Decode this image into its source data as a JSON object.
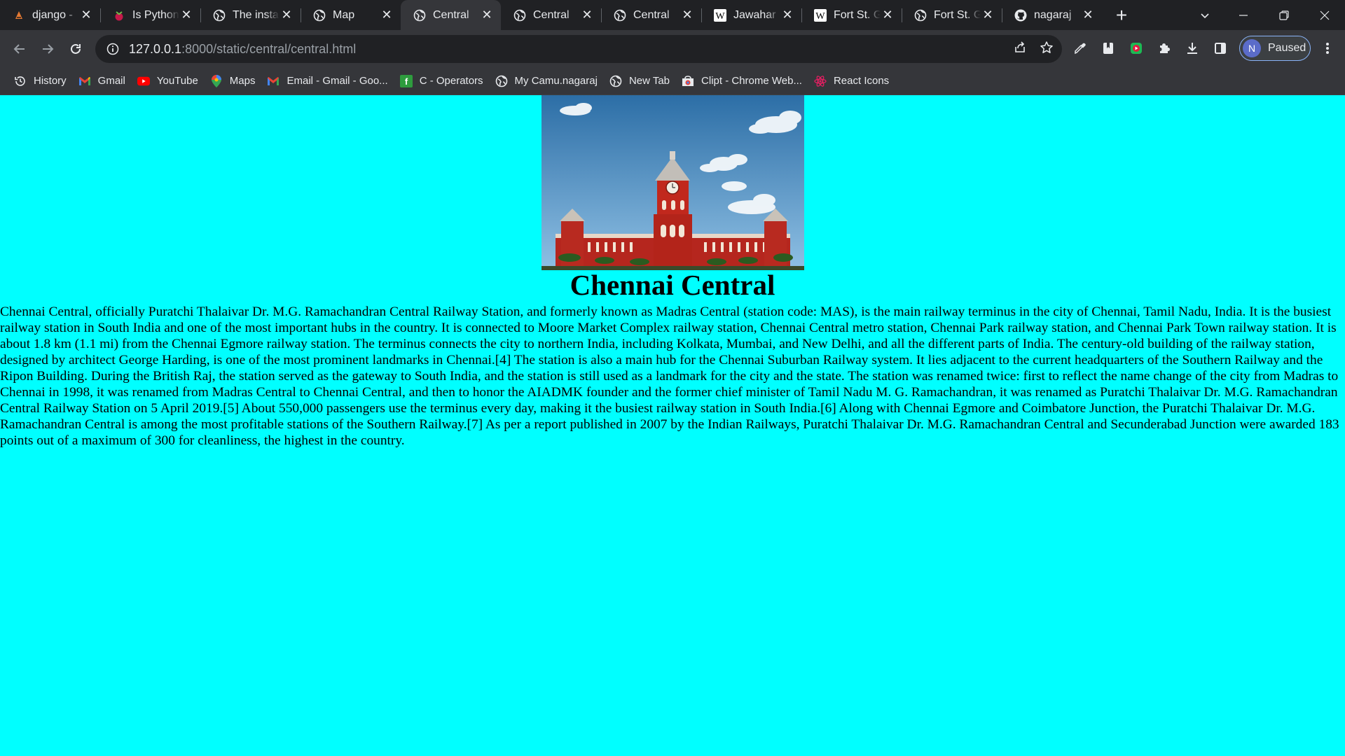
{
  "browser": {
    "tabs": [
      {
        "title": "django -",
        "favicon": "python-anywhere-icon",
        "active": false
      },
      {
        "title": "Is Python",
        "favicon": "raspberry-pi-icon",
        "active": false
      },
      {
        "title": "The insta",
        "favicon": "globe-icon",
        "active": false
      },
      {
        "title": "Map",
        "favicon": "globe-icon",
        "active": false
      },
      {
        "title": "Central",
        "favicon": "globe-icon",
        "active": true
      },
      {
        "title": "Central",
        "favicon": "globe-icon",
        "active": false
      },
      {
        "title": "Central",
        "favicon": "globe-icon",
        "active": false
      },
      {
        "title": "Jawahar",
        "favicon": "wikipedia-icon",
        "active": false
      },
      {
        "title": "Fort St. G",
        "favicon": "wikipedia-icon",
        "active": false
      },
      {
        "title": "Fort St. G",
        "favicon": "globe-icon",
        "active": false
      },
      {
        "title": "nagaraj",
        "favicon": "github-icon",
        "active": false
      }
    ],
    "address": {
      "host": "127.0.0.1",
      "path": ":8000/static/central/central.html"
    },
    "profile": {
      "initial": "N",
      "label": "Paused"
    },
    "bookmarks": [
      {
        "label": "History",
        "icon": "history-icon"
      },
      {
        "label": "Gmail",
        "icon": "gmail-icon"
      },
      {
        "label": "YouTube",
        "icon": "youtube-icon"
      },
      {
        "label": "Maps",
        "icon": "maps-icon"
      },
      {
        "label": "Email - Gmail - Goo...",
        "icon": "gmail-icon"
      },
      {
        "label": "C - Operators",
        "icon": "operators-icon"
      },
      {
        "label": "My Camu.nagaraj",
        "icon": "globe-icon"
      },
      {
        "label": "New Tab",
        "icon": "globe-icon"
      },
      {
        "label": "Clipt - Chrome Web...",
        "icon": "chrome-web-store-icon"
      },
      {
        "label": "React Icons",
        "icon": "react-icons-icon"
      }
    ]
  },
  "page": {
    "title": "Chennai Central",
    "body": "Chennai Central, officially Puratchi Thalaivar Dr. M.G. Ramachandran Central Railway Station, and formerly known as Madras Central (station code: MAS), is the main railway terminus in the city of Chennai, Tamil Nadu, India. It is the busiest railway station in South India and one of the most important hubs in the country. It is connected to Moore Market Complex railway station, Chennai Central metro station, Chennai Park railway station, and Chennai Park Town railway station. It is about 1.8 km (1.1 mi) from the Chennai Egmore railway station. The terminus connects the city to northern India, including Kolkata, Mumbai, and New Delhi, and all the different parts of India. The century-old building of the railway station, designed by architect George Harding, is one of the most prominent landmarks in Chennai.[4] The station is also a main hub for the Chennai Suburban Railway system. It lies adjacent to the current headquarters of the Southern Railway and the Ripon Building. During the British Raj, the station served as the gateway to South India, and the station is still used as a landmark for the city and the state. The station was renamed twice: first to reflect the name change of the city from Madras to Chennai in 1998, it was renamed from Madras Central to Chennai Central, and then to honor the AIADMK founder and the former chief minister of Tamil Nadu M. G. Ramachandran, it was renamed as Puratchi Thalaivar Dr. M.G. Ramachandran Central Railway Station on 5 April 2019.[5] About 550,000 passengers use the terminus every day, making it the busiest railway station in South India.[6] Along with Chennai Egmore and Coimbatore Junction, the Puratchi Thalaivar Dr. M.G. Ramachandran Central is among the most profitable stations of the Southern Railway.[7] As per a report published in 2007 by the Indian Railways, Puratchi Thalaivar Dr. M.G. Ramachandran Central and Secunderabad Junction were awarded 183 points out of a maximum of 300 for cleanliness, the highest in the country.",
    "background_color": "#00ffff"
  }
}
